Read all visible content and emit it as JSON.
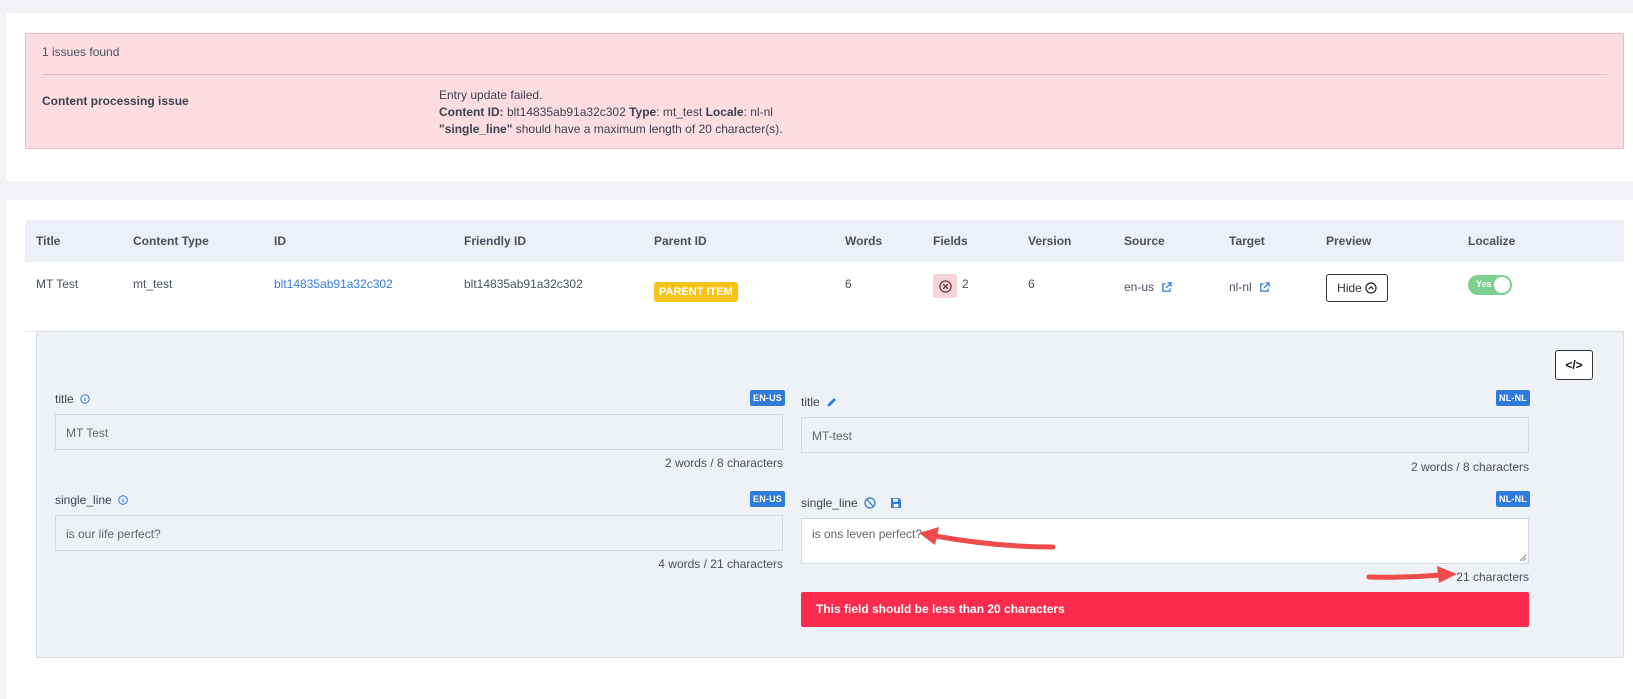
{
  "issues": {
    "count_text": "1 issues found",
    "title": "Content processing issue",
    "line1": "Entry update failed.",
    "content_id_label": "Content ID:",
    "content_id_value": " blt14835ab91a32c302 ",
    "type_label": "Type",
    "type_value": ": mt_test ",
    "locale_label": "Locale",
    "locale_value": ": nl-nl",
    "field_name": "\"single_line\"",
    "field_msg": " should have a maximum length of 20 character(s)."
  },
  "table": {
    "headers": [
      "Title",
      "Content Type",
      "ID",
      "Friendly ID",
      "Parent ID",
      "Words",
      "Fields",
      "Version",
      "Source",
      "Target",
      "Preview",
      "Localize"
    ],
    "row": {
      "title": "MT Test",
      "content_type": "mt_test",
      "id": "blt14835ab91a32c302",
      "friendly_id": "blt14835ab91a32c302",
      "parent_badge": "PARENT ITEM",
      "words": "6",
      "fields": "2",
      "version": "6",
      "source": "en-us",
      "target": "nl-nl",
      "preview_btn": "Hide",
      "localize_toggle": "Yes"
    }
  },
  "panel": {
    "code_btn": "</>",
    "source": {
      "badge": "EN-US",
      "fields": [
        {
          "label": "title",
          "value": "MT Test",
          "meta": "2 words / 8 characters"
        },
        {
          "label": "single_line",
          "value": "is our life perfect?",
          "meta": "4 words / 21 characters"
        }
      ]
    },
    "target": {
      "badge": "NL-NL",
      "fields": [
        {
          "label": "title",
          "value": "MT-test",
          "meta": "2 words / 8 characters"
        },
        {
          "label": "single_line",
          "value": "is ons leven perfect?",
          "meta": "21 characters"
        }
      ],
      "error": "This field should be less than 20 characters"
    }
  },
  "colors": {
    "error_bg": "#fddde2",
    "accent_blue": "#2f7bdc",
    "badge_yellow": "#f8c413",
    "toggle_green": "#7ed08f",
    "error_red": "#fb2b4e",
    "arrow_red": "#ef4b4b"
  }
}
